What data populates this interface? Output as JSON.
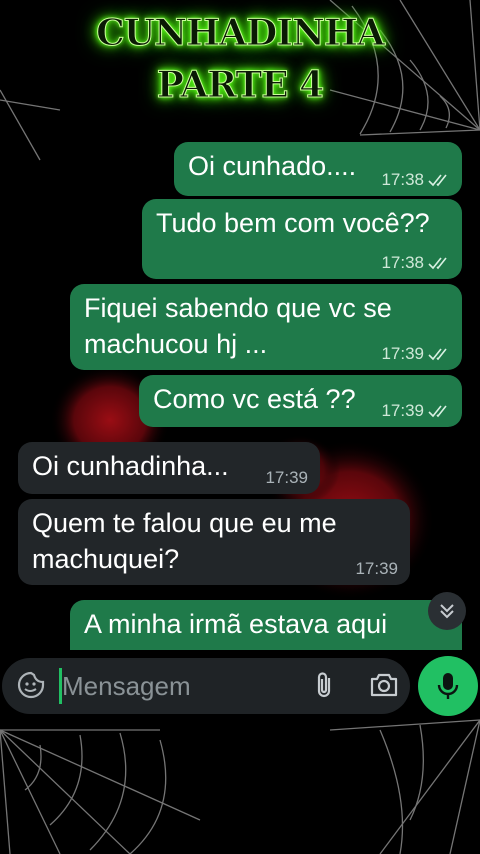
{
  "banner": {
    "line1": "CUNHADINHA",
    "line2": "PARTE 4"
  },
  "messages": [
    {
      "direction": "outgoing",
      "text": "Oi cunhado....",
      "time": "17:38",
      "status": "read"
    },
    {
      "direction": "outgoing",
      "text": "Tudo bem com você??",
      "time": "17:38",
      "status": "read"
    },
    {
      "direction": "outgoing",
      "text": "Fiquei sabendo que vc se\nmachucou hj ...",
      "time": "17:39",
      "status": "read"
    },
    {
      "direction": "outgoing",
      "text": "Como vc está ??",
      "time": "17:39",
      "status": "read"
    },
    {
      "direction": "incoming",
      "text": "Oi cunhadinha...",
      "time": "17:39"
    },
    {
      "direction": "incoming",
      "text": "Quem te falou que eu me\nmachuquei?",
      "time": "17:39"
    },
    {
      "direction": "outgoing",
      "text": "A minha irmã estava aqui",
      "time": "",
      "status": ""
    }
  ],
  "composer": {
    "placeholder": "Mensagem"
  },
  "icons": {
    "emoji": "sticker-emoji-icon",
    "attach": "paperclip-icon",
    "camera": "camera-icon",
    "send": "microphone-icon",
    "scroll": "double-chevron-down-icon"
  },
  "colors": {
    "outgoing": "#1f7a4a",
    "incoming": "#222629",
    "accent": "#21c063",
    "title_glow": "#5cff1a"
  }
}
